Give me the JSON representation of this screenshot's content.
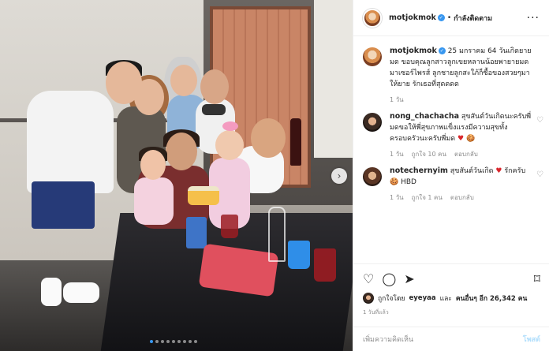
{
  "photo": {
    "alt": "",
    "carousel_next": "›",
    "dots_count": 9,
    "active_dot": 0
  },
  "header": {
    "username": "motjokmok",
    "verified": "✓",
    "separator": "•",
    "follow_label": "กำลังติดตาม",
    "more_label": "···"
  },
  "caption": {
    "username": "motjokmok",
    "verified": "✓",
    "text": "25 มกราคม 64 วันเกิดยายมด ขอบคุณลูกสาวลูกเขยหลานน้อยพายายมดมาเซอร์ไพรส์ ลูกชายลูกสะใภ้ก็ซื้อของสวยๆมาให้ยาย รักเธอที่สุดดดด",
    "time": "1 วัน"
  },
  "comments": [
    {
      "username": "nong_chachacha",
      "text": "สุขสันต์วันเกิดนะครับพี่มดขอให้พี่สุขภาพแข็งแรงมีความสุขทั้งครอบครัวนะครับพี่มด",
      "emoji": "♥ 🍪",
      "time": "1 วัน",
      "likes": "ถูกใจ 10 คน",
      "reply": "ตอบกลับ",
      "heart": "♡"
    },
    {
      "username": "notechernyim",
      "text": "สุขสันต์วันเกิด",
      "emoji": "♥",
      "text2": "รักครับ",
      "emoji2": "🍪",
      "text3": "HBD",
      "time": "1 วัน",
      "likes": "ถูกใจ 1 คน",
      "reply": "ตอบกลับ",
      "heart": "♡"
    }
  ],
  "actions": {
    "like_icon": "♡",
    "comment_icon": "◯",
    "share_icon": "➤",
    "bookmark_icon": "⌑",
    "liked_by_prefix": "ถูกใจโดย",
    "liked_by_user": "eyeyaa",
    "liked_by_and": "และ",
    "liked_by_others": "คนอื่นๆ อีก 26,342 คน",
    "date": "1 วันที่แล้ว"
  },
  "add_comment": {
    "placeholder": "เพิ่มความคิดเห็น",
    "post_label": "โพสต์"
  },
  "colors": {
    "accent": "#3897f0",
    "text": "#262626",
    "muted": "#8e8e8e",
    "post_disabled": "#b2dffc"
  }
}
